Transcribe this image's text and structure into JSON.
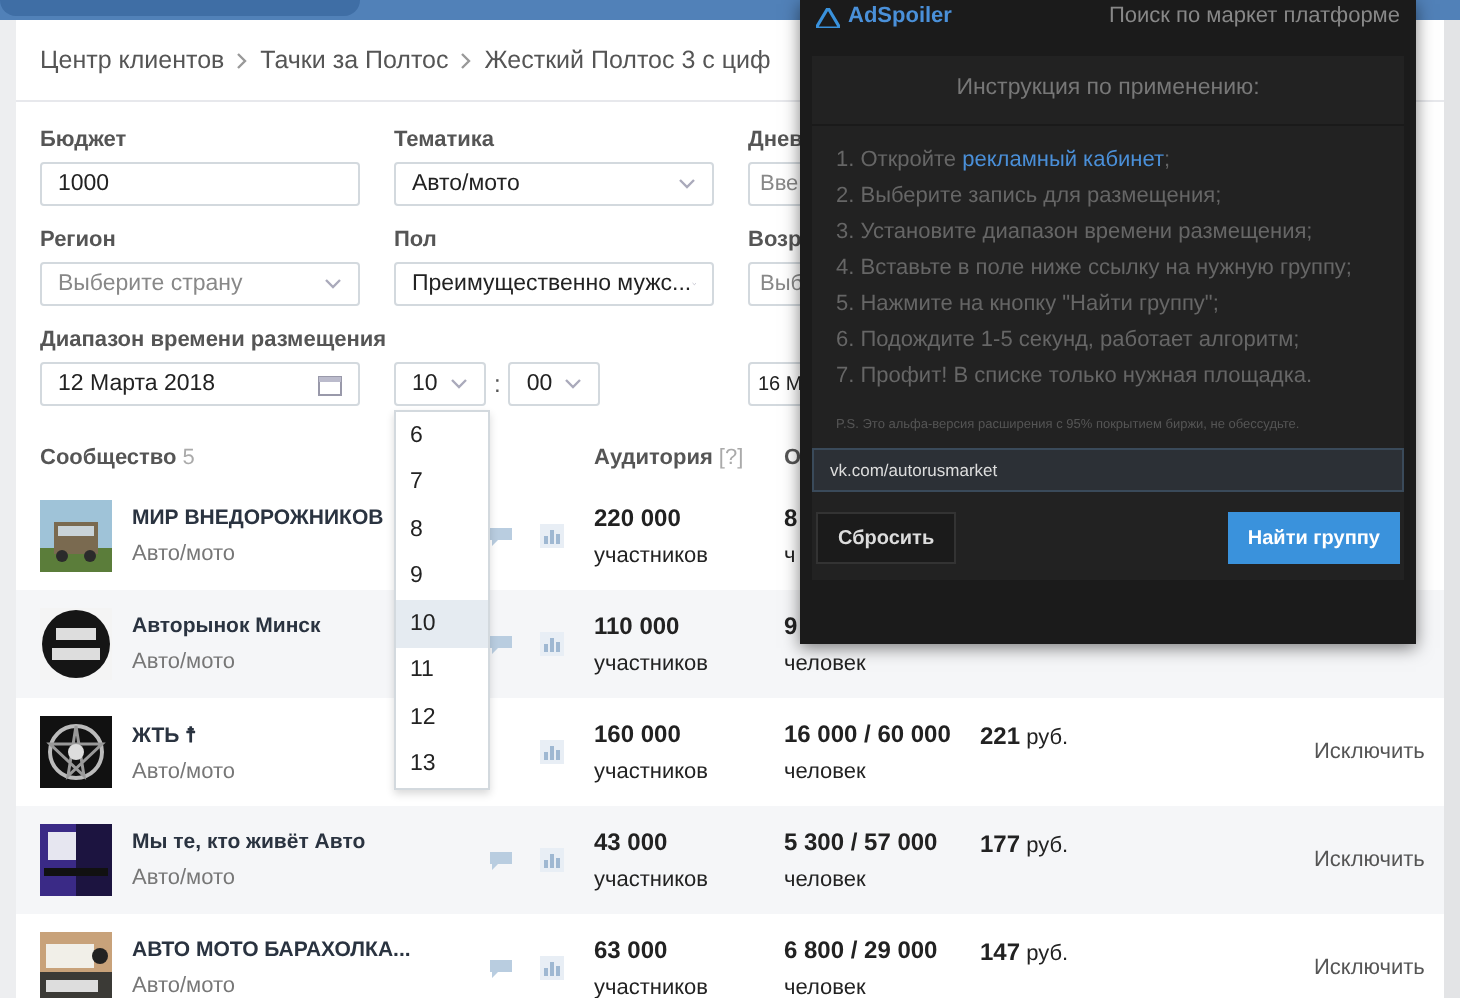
{
  "breadcrumbs": [
    "Центр клиентов",
    "Тачки за Полтос",
    "Жесткий Полтос 3 с циф"
  ],
  "form": {
    "budget": {
      "label": "Бюджет",
      "value": "1000"
    },
    "topic": {
      "label": "Тематика",
      "value": "Авто/мото"
    },
    "daily": {
      "label": "Днев",
      "placeholder": "Вве"
    },
    "region": {
      "label": "Регион",
      "placeholder": "Выберите страну"
    },
    "gender": {
      "label": "Пол",
      "value": "Преимущественно мужс..."
    },
    "age": {
      "label": "Возр",
      "placeholder": "Выб"
    },
    "range": {
      "label": "Диапазон времени размещения",
      "date": "12 Марта 2018",
      "hour": "10",
      "separator": ":",
      "minute": "00",
      "end_date": "16 М"
    }
  },
  "hour_options": [
    {
      "label": "6",
      "selected": false
    },
    {
      "label": "7",
      "selected": false
    },
    {
      "label": "8",
      "selected": false
    },
    {
      "label": "9",
      "selected": false
    },
    {
      "label": "10",
      "selected": true
    },
    {
      "label": "11",
      "selected": false
    },
    {
      "label": "12",
      "selected": false
    },
    {
      "label": "13",
      "selected": false
    }
  ],
  "table": {
    "columns": {
      "community": "Сообщество",
      "count": "5",
      "audience": "Аудитория",
      "hint": "[?]",
      "coverage": "О"
    },
    "rows": [
      {
        "name": "МИР ВНЕДОРОЖНИКОВ",
        "category": "Авто/мото",
        "comments": true,
        "audience": "220 000",
        "audience_unit": "участников",
        "coverage": "8",
        "coverage_unit": "ч"
      },
      {
        "name": "Авторынок Минск",
        "category": "Авто/мото",
        "comments": true,
        "audience": "110 000",
        "audience_unit": "участников",
        "coverage": "9",
        "coverage_unit": "человек"
      },
      {
        "name": "ЖТЬ ☨",
        "category": "Авто/мото",
        "comments": false,
        "audience": "160 000",
        "audience_unit": "участников",
        "coverage": "16 000 / 60 000",
        "coverage_unit": "человек",
        "price": "**221** руб.",
        "action": "Исключить"
      },
      {
        "name": "Мы те, кто живёт Авто",
        "category": "Авто/мото",
        "comments": true,
        "audience": "43 000",
        "audience_unit": "участников",
        "coverage": "5 300 / 57 000",
        "coverage_unit": "человек",
        "price": "**177** руб.",
        "action": "Исключить"
      },
      {
        "name": "АВТО МОТО БАРАХОЛКА...",
        "category": "Авто/мото",
        "comments": true,
        "audience": "63 000",
        "audience_unit": "участников",
        "coverage": "6 800 / 29 000",
        "coverage_unit": "человек",
        "price": "**147** руб.",
        "action": "Исключить"
      }
    ]
  },
  "popup": {
    "brand": "AdSpoiler",
    "subtitle": "Поиск по маркет платформе",
    "title": "Инструкция по применению:",
    "steps": [
      {
        "text": "1. Откройте ",
        "link": "рекламный кабинет",
        "after": ";"
      },
      {
        "text": "2. Выберите запись для размещения;"
      },
      {
        "text": "3. Установите диапазон времени размещения;"
      },
      {
        "text": "4. Вставьте в поле ниже ссылку на нужную группу;"
      },
      {
        "text": "5. Нажмите на кнопку \"Найти группу\";"
      },
      {
        "text": "6. Подождите 1-5 секунд, работает алгоритм;"
      },
      {
        "text": "7. Профит! В списке только нужная площадка."
      }
    ],
    "note": "P.S. Это альфа-версия расширения с 95% покрытием биржи, не обессудьте.",
    "url": "vk.com/autorusmarket",
    "reset": "Сбросить",
    "find": "Найти группу"
  }
}
